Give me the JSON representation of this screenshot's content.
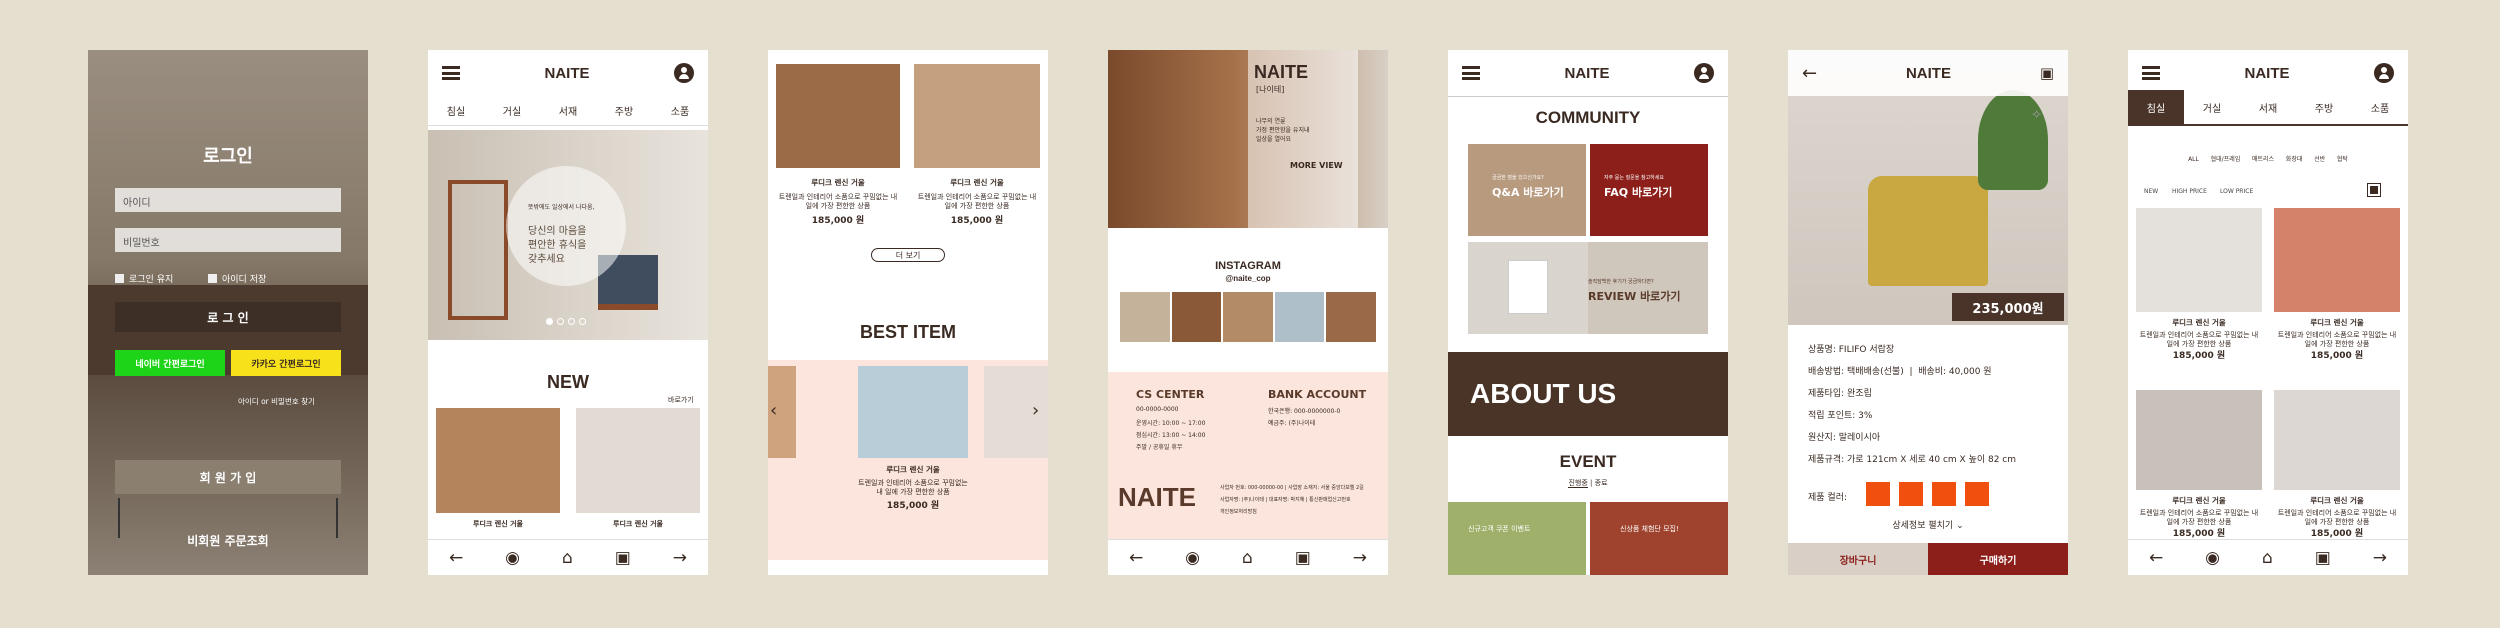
{
  "nav": {
    "brand": "NAITE",
    "cats": [
      "침실",
      "거실",
      "서재",
      "주방",
      "소품"
    ]
  },
  "s1": {
    "title": "로그인",
    "id_placeholder": "아이디",
    "pw_placeholder": "비밀번호",
    "keep": "로그인 유지",
    "save_id": "아이디 저장",
    "login": "로 그 인",
    "naver": "네이버 간편로그인",
    "kakao": "카카오 간편로그인",
    "find": "아이디 or 비밀번호 찾기",
    "join": "회 원 가 입",
    "guest": "비회원 주문조회"
  },
  "s2": {
    "banner_l1": "뜻밖에도 일상에서 나다움,",
    "banner_l2": "당신의 마음을",
    "banner_l3": "편안한 휴식을",
    "banner_l4": "갖추세요",
    "new": "NEW",
    "more": "바로가기",
    "p1": "루디크 렌신 거울",
    "p2": "루디크 렌신 거울"
  },
  "s3": {
    "p1": "루디크 렌신 거울",
    "p2": "루디크 렌신 거울",
    "desc": "트렌일과 인테리어 소품으로 꾸밈없는 내 일에 가장 편한한 상품",
    "price": "185,000 원",
    "more": "더 보기",
    "best": "BEST ITEM"
  },
  "s4": {
    "brand": "NAITE",
    "sub": "[나이테]",
    "text1": "나무의 연륜",
    "text2": "가정 편안함을 유지내",
    "text3": "일상을 열어요",
    "more": "MORE VIEW",
    "insta": "INSTAGRAM",
    "handle": "@naite_cop",
    "cs": "CS CENTER",
    "tel": "00-0000-0000",
    "h1": "운영시간: 10:00 ~ 17:00",
    "h2": "점심시간: 13:00 ~ 14:00",
    "h3": "주말 / 공휴일 휴무",
    "bank": "BANK ACCOUNT",
    "acc1": "한국은행: 000-0000000-0",
    "acc2": "예금주: (주)나이테",
    "foot_brand": "NAITE",
    "foot1": "사업자 번호: 000-00000-00 | 사업장 소재지: 서울 중앙다보엘 2길",
    "foot2": "사업자명: (주)나이테 | 대표자명: 박지혜 | 통신판매업신고번호",
    "foot3": "개인정보처리방침"
  },
  "s5": {
    "community": "COMMUNITY",
    "qa_small": "궁금한 점을 있으신가요?",
    "qa": "Q&A 바로가기",
    "faq_small": "자주 묻는 질문을 참고하세요",
    "faq": "FAQ 바로가기",
    "rev_small": "솔직담백한 후기가 궁금하다면?",
    "rev": "REVIEW 바로가기",
    "about": "ABOUT US",
    "event": "EVENT",
    "tab1": "진행중",
    "tab2": "종료",
    "ev1": "신규고객 쿠폰 이벤트",
    "ev2": "신상품 체험단 모집!"
  },
  "s6": {
    "price": "235,000원",
    "name": "상품명: FILIFO 서랍장",
    "ship_l": "배송방법: 택배배송(선불)",
    "ship_fee": "배송비: 40,000 원",
    "maker": "제품타입: 완조립",
    "point": "적립 포인트: 3%",
    "origin": "원산지: 말레이시아",
    "size": "제품규격: 가로 121cm X 세로 40 cm X 높이 82 cm",
    "color": "제품 컬러:",
    "detail": "상세정보 펼치기",
    "cart": "장바구니",
    "buy": "구매하기"
  },
  "s7": {
    "cats": [
      "침실",
      "거실",
      "서재",
      "주방",
      "소품"
    ],
    "filters": [
      "ALL",
      "협대/프레임",
      "매트리스",
      "화장대",
      "선반",
      "협탁"
    ],
    "sort": [
      "NEW",
      "HIGH PRICE",
      "LOW PRICE"
    ],
    "p": "루디크 렌신 거울",
    "desc": "트렌일과 인테리어 소품으로 꾸밈없는 내 일에 가장 편한한 상품",
    "price": "185,000 원"
  }
}
